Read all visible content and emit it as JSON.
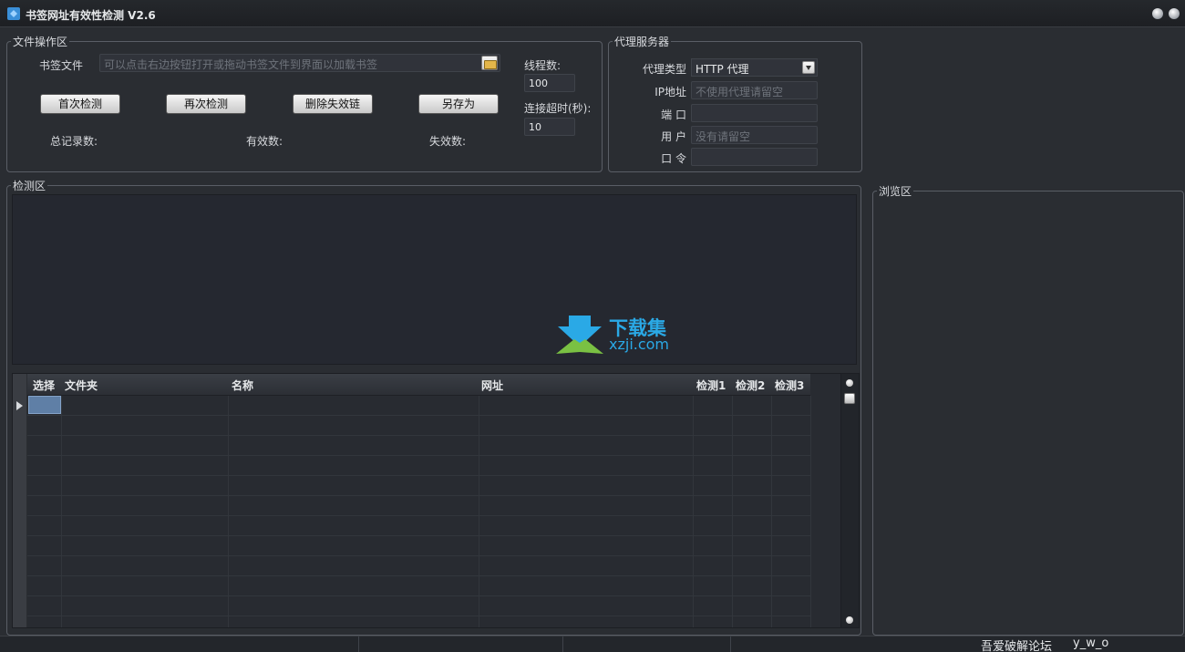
{
  "titlebar": {
    "title": "书签网址有效性检测 V2.6"
  },
  "file_ops": {
    "legend": "文件操作区",
    "bookmark_label": "书签文件",
    "bookmark_placeholder": "可以点击右边按钮打开或拖动书签文件到界面以加载书签",
    "buttons": {
      "first_check": "首次检测",
      "recheck": "再次检测",
      "delete_invalid": "删除失效链",
      "save_as": "另存为"
    },
    "stats": {
      "total": "总记录数:",
      "valid": "有效数:",
      "invalid": "失效数:"
    },
    "threads_label": "线程数:",
    "threads_value": "100",
    "timeout_label": "连接超时(秒):",
    "timeout_value": "10"
  },
  "proxy": {
    "legend": "代理服务器",
    "type_label": "代理类型",
    "type_value": "HTTP 代理",
    "ip_label": "IP地址",
    "ip_placeholder": "不使用代理请留空",
    "port_label": "端 口",
    "user_label": "用 户",
    "user_placeholder": "没有请留空",
    "password_label": "口 令"
  },
  "detect": {
    "legend": "检测区"
  },
  "watermark": {
    "line1": "下载集",
    "line2": "xzji.com"
  },
  "table": {
    "columns": [
      "选择",
      "文件夹",
      "名称",
      "网址",
      "检测1",
      "检测2",
      "检测3"
    ]
  },
  "browse": {
    "legend": "浏览区"
  },
  "statusbar": {
    "forum": "吾爱破解论坛",
    "author": "y_w_o"
  },
  "colors": {
    "background": "#2a2d32",
    "accent": "#2aa9e6",
    "selection": "#5f7fa6"
  },
  "icons": [
    "app-icon",
    "folder-icon",
    "chevron-down-icon",
    "minimize-icon",
    "close-icon"
  ]
}
